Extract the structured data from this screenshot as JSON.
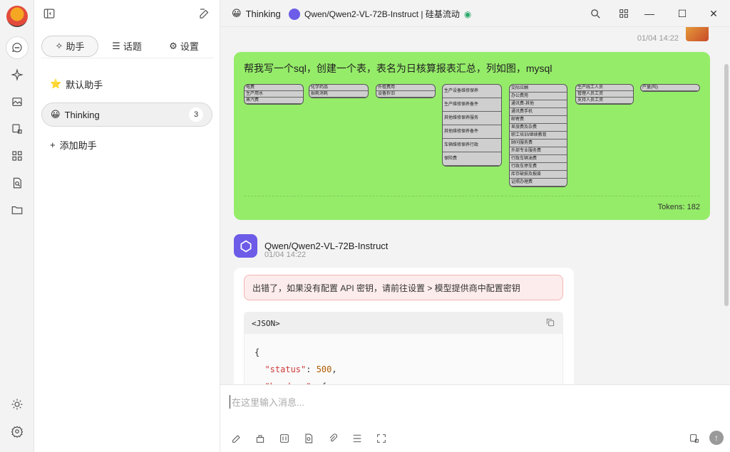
{
  "topbar": {
    "assistant_emoji": "😀",
    "assistant_name": "Thinking",
    "model_title": "Qwen/Qwen2-VL-72B-Instruct | 硅基流动"
  },
  "panel": {
    "tabs": [
      {
        "label": "助手",
        "icon": "sparkle-icon"
      },
      {
        "label": "话题",
        "icon": "list-icon"
      },
      {
        "label": "设置",
        "icon": "gear-icon"
      }
    ],
    "assistants": [
      {
        "label": "默认助手",
        "icon": "⭐"
      },
      {
        "label": "Thinking",
        "icon": "😀",
        "count": "3"
      }
    ],
    "add_label": "添加助手"
  },
  "chat": {
    "user_time": "01/04 14:22",
    "user_message": "帮我写一个sql，创建一个表，表名为日核算报表汇总，列如图，mysql",
    "tokens": "Tokens: 182",
    "image_tables": [
      [
        "电费",
        "生产用水",
        "蒸汽费"
      ],
      [
        "化学药品",
        "损耗消耗"
      ],
      [
        "外租费用",
        "设备折旧"
      ],
      [
        "生产设备维修保养",
        "生产维修保养备件",
        "其他维修保养服务",
        "其他维修保养备件",
        "车辆维修保养行政",
        "保险费"
      ],
      [
        "交际应酬",
        "办公费用",
        "通讯费-其他",
        "通讯费手机",
        "邮寄费",
        "差旅费及杂费",
        "职工培训/继续教育",
        "顾问服务费",
        "外部专业服务费",
        "行政车辆油费",
        "行政车停车费",
        "库存破损及报废",
        "证照办理费"
      ],
      [
        "生产线工人员",
        "管理人员工资",
        "支持人员工资"
      ],
      [
        "产量(吨)"
      ]
    ],
    "bot_name": "Qwen/Qwen2-VL-72B-Instruct",
    "bot_time": "01/04 14:22",
    "error_text": "出错了，如果没有配置 API 密钥，请前往设置 > 模型提供商中配置密钥",
    "code_lang": "<JSON>",
    "code_lines": [
      "{",
      "\"status\": 500,",
      "\"headers\": {"
    ]
  },
  "input": {
    "placeholder": "在这里输入消息..."
  }
}
